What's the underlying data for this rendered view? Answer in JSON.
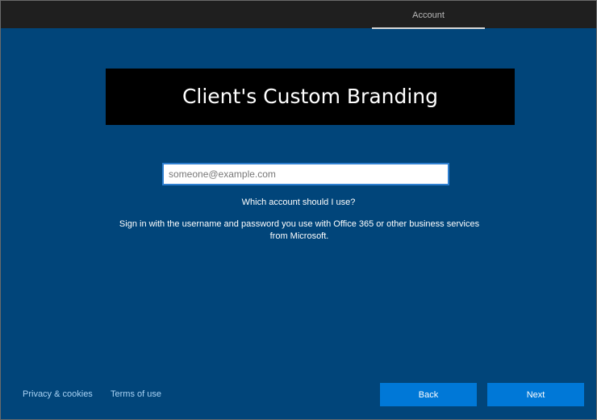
{
  "header": {
    "tab_label": "Account"
  },
  "branding": {
    "text": "Client's Custom Branding"
  },
  "form": {
    "email_placeholder": "someone@example.com",
    "email_value": "",
    "help_link": "Which account should I use?",
    "description": "Sign in with the username and password you use with Office 365 or other business services from Microsoft."
  },
  "footer": {
    "privacy_label": "Privacy & cookies",
    "terms_label": "Terms of use",
    "back_label": "Back",
    "next_label": "Next"
  },
  "colors": {
    "background": "#01457a",
    "button": "#0078d7",
    "topbar": "#1f1f1f"
  }
}
